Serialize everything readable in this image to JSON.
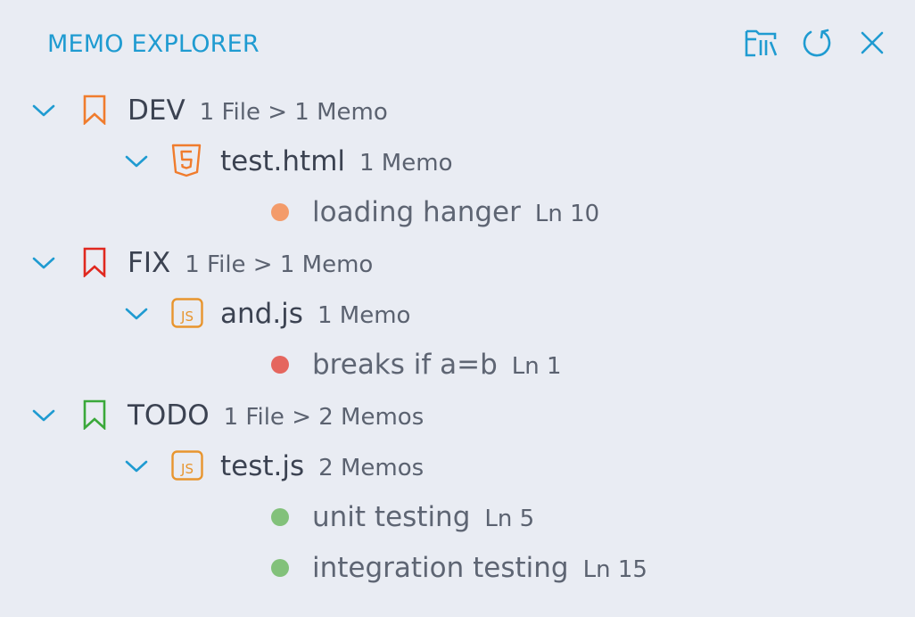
{
  "panel": {
    "title": "MEMO EXPLORER",
    "accent_color": "#1f9bd1",
    "actions": [
      {
        "name": "open-memo-file-icon",
        "tooltip": ""
      },
      {
        "name": "refresh-icon",
        "tooltip": ""
      },
      {
        "name": "close-icon",
        "tooltip": ""
      }
    ]
  },
  "groups": [
    {
      "tag": "DEV",
      "summary": "1 File > 1 Memo",
      "bookmark_color": "#f07c2d",
      "files": [
        {
          "name": "test.html",
          "summary": "1 Memo",
          "icon": "html5-icon",
          "memos": [
            {
              "text": "loading hanger",
              "line": "Ln 10",
              "dot_color": "#f39b6a"
            }
          ]
        }
      ]
    },
    {
      "tag": "FIX",
      "summary": "1 File > 1 Memo",
      "bookmark_color": "#e0281f",
      "files": [
        {
          "name": "and.js",
          "summary": "1 Memo",
          "icon": "javascript-icon",
          "memos": [
            {
              "text": "breaks if a=b",
              "line": "Ln 1",
              "dot_color": "#e5665e"
            }
          ]
        }
      ]
    },
    {
      "tag": "TODO",
      "summary": "1 File > 2 Memos",
      "bookmark_color": "#3aa83a",
      "files": [
        {
          "name": "test.js",
          "summary": "2 Memos",
          "icon": "javascript-icon",
          "memos": [
            {
              "text": "unit testing",
              "line": "Ln 5",
              "dot_color": "#82c17a"
            },
            {
              "text": "integration testing",
              "line": "Ln 15",
              "dot_color": "#82c17a"
            }
          ]
        }
      ]
    }
  ]
}
